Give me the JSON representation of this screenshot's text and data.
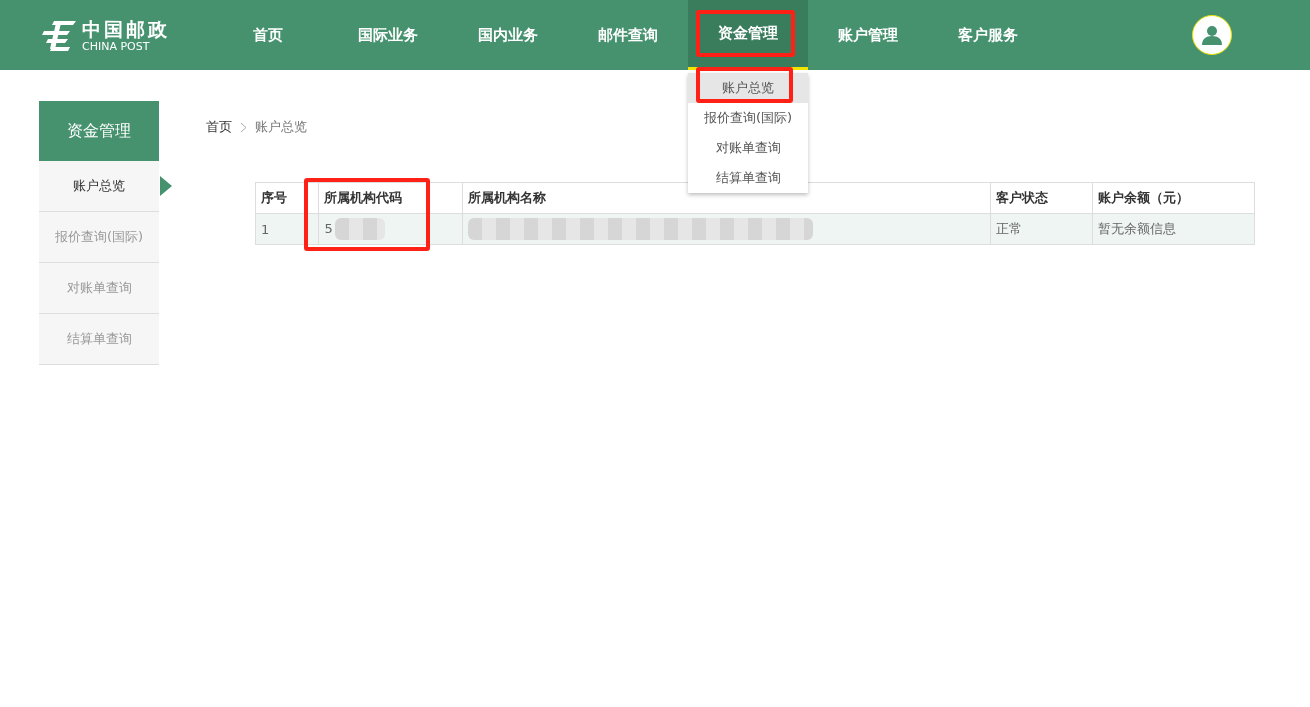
{
  "header": {
    "logo": {
      "name": "中国邮政",
      "subtitle": "CHINA POST"
    },
    "nav": [
      {
        "label": "首页",
        "selected": false,
        "highlighted": false
      },
      {
        "label": "国际业务",
        "selected": false,
        "highlighted": false
      },
      {
        "label": "国内业务",
        "selected": false,
        "highlighted": false
      },
      {
        "label": "邮件查询",
        "selected": false,
        "highlighted": false
      },
      {
        "label": "资金管理",
        "selected": true,
        "highlighted": true,
        "dropdown": [
          {
            "label": "账户总览",
            "selected": true,
            "highlighted": true
          },
          {
            "label": "报价查询(国际)",
            "selected": false,
            "highlighted": false
          },
          {
            "label": "对账单查询",
            "selected": false,
            "highlighted": false
          },
          {
            "label": "结算单查询",
            "selected": false,
            "highlighted": false
          }
        ]
      },
      {
        "label": "账户管理",
        "selected": false,
        "highlighted": false
      },
      {
        "label": "客户服务",
        "selected": false,
        "highlighted": false
      }
    ]
  },
  "sidebar": {
    "title": "资金管理",
    "items": [
      {
        "label": "账户总览",
        "selected": true
      },
      {
        "label": "报价查询(国际)",
        "selected": false
      },
      {
        "label": "对账单查询",
        "selected": false
      },
      {
        "label": "结算单查询",
        "selected": false
      }
    ]
  },
  "breadcrumb": [
    "首页",
    "账户总览"
  ],
  "table": {
    "columns": [
      {
        "label": "序号",
        "highlighted": false
      },
      {
        "label": "所属机构代码",
        "highlighted": true
      },
      {
        "label": "所属机构名称",
        "highlighted": false
      },
      {
        "label": "客户状态",
        "highlighted": false
      },
      {
        "label": "账户余额（元）",
        "highlighted": false
      }
    ],
    "rows": [
      {
        "cells": [
          {
            "text": "1",
            "redacted": false
          },
          {
            "text": "5",
            "redacted": true
          },
          {
            "text": "",
            "redacted": true
          },
          {
            "text": "正常",
            "redacted": false
          },
          {
            "text": "暂无余额信息",
            "redacted": false
          }
        ]
      }
    ]
  }
}
